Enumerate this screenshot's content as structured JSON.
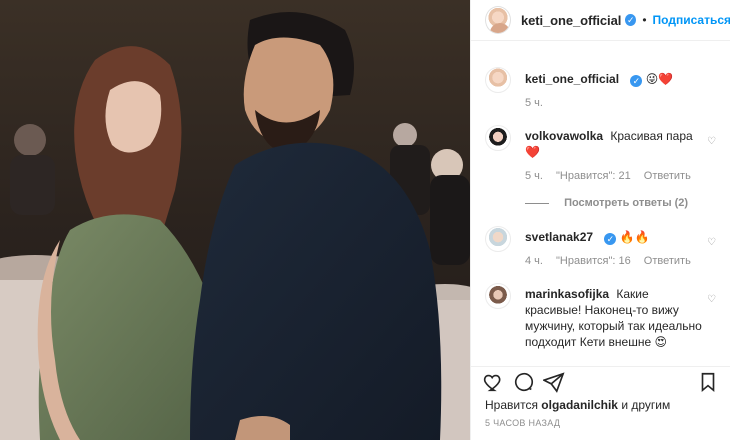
{
  "post": {
    "author": "keti_one_official",
    "follow_label": "Подписаться",
    "caption_emoji": "😜❤️",
    "caption_time": "5 ч."
  },
  "comments": [
    {
      "username": "volkovawolka",
      "text": "Красивая пара ❤️",
      "time": "5 ч.",
      "likes": "\"Нравится\": 21",
      "reply": "Ответить",
      "view_replies": "Посмотреть ответы (2)"
    },
    {
      "username": "svetlanak27",
      "text": "🔥🔥",
      "time": "4 ч.",
      "likes": "\"Нравится\": 16",
      "reply": "Ответить"
    },
    {
      "username": "marinkasofijka",
      "text": "Какие красивые! Наконец-то вижу мужчину, который так идеально подходит Кети внешне 😍"
    }
  ],
  "footer": {
    "likes_prefix": "Нравится",
    "likes_user": "olgadanilchik",
    "likes_suffix": "и другим",
    "time_ago": "5 ЧАСОВ НАЗАД"
  },
  "icons": [
    "like-icon",
    "comment-icon",
    "share-icon",
    "save-icon",
    "verified-icon",
    "heart-icon"
  ],
  "colors": {
    "accent": "#0095f6",
    "verified": "#3897f0",
    "muted": "#8e8e8e",
    "text": "#262626"
  }
}
